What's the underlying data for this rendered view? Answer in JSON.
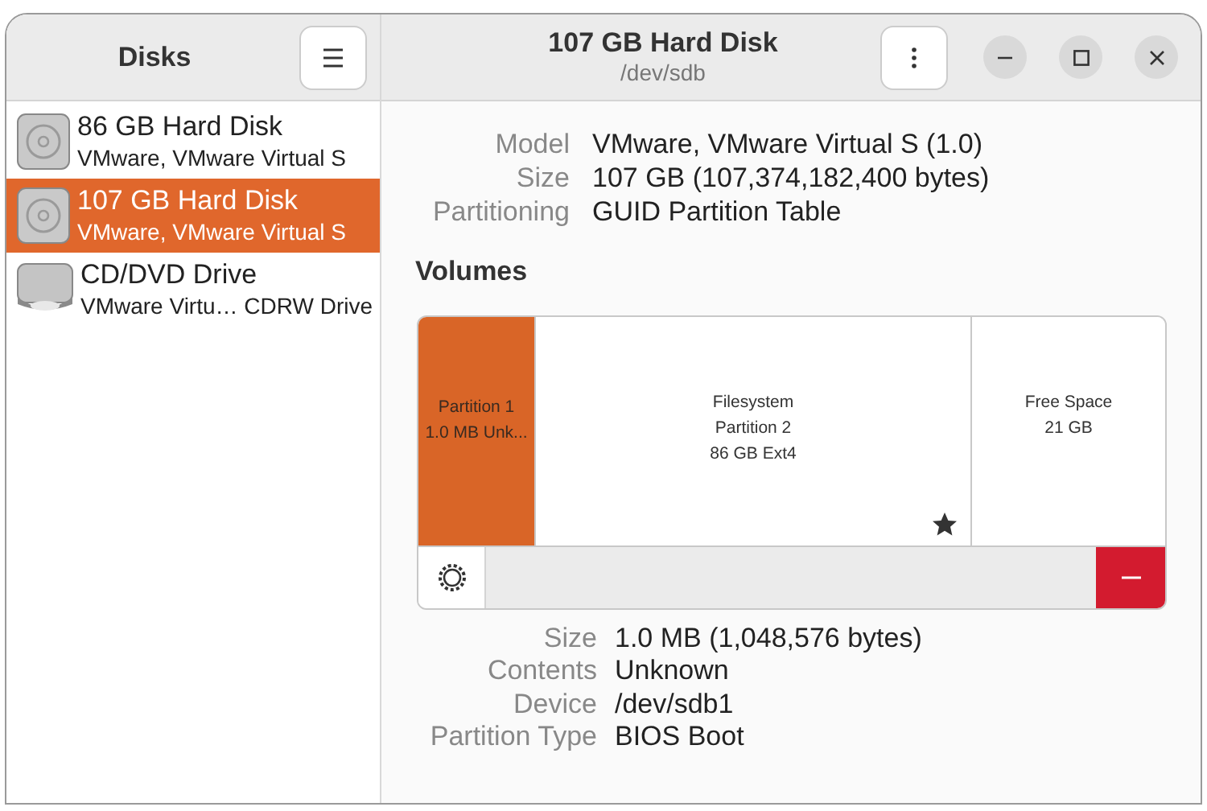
{
  "sidebar": {
    "title": "Disks",
    "items": [
      {
        "kind": "hdd",
        "name": "86 GB Hard Disk",
        "detail": "VMware, VMware Virtual S",
        "selected": false
      },
      {
        "kind": "hdd",
        "name": "107 GB Hard Disk",
        "detail": "VMware, VMware Virtual S",
        "selected": true
      },
      {
        "kind": "optical",
        "name": "CD/DVD Drive",
        "detail": "VMware Virtu… CDRW Drive",
        "selected": false
      }
    ]
  },
  "header": {
    "title": "107 GB Hard Disk",
    "subtitle": "/dev/sdb"
  },
  "disk_info": [
    {
      "label": "Model",
      "value": "VMware, VMware Virtual S (1.0)"
    },
    {
      "label": "Size",
      "value": "107 GB (107,374,182,400 bytes)"
    },
    {
      "label": "Partitioning",
      "value": "GUID Partition Table"
    }
  ],
  "volumes": {
    "title": "Volumes",
    "partitions": [
      {
        "lines": [
          "Partition 1",
          "1.0 MB Unk..."
        ],
        "selected": true,
        "starred": false
      },
      {
        "lines": [
          "Filesystem",
          "Partition 2",
          "86 GB Ext4"
        ],
        "selected": false,
        "starred": true
      },
      {
        "lines": [
          "Free Space",
          "21 GB"
        ],
        "selected": false,
        "starred": false
      }
    ]
  },
  "partition_info": [
    {
      "label": "Size",
      "value": "1.0 MB (1,048,576 bytes)"
    },
    {
      "label": "Contents",
      "value": "Unknown"
    },
    {
      "label": "Device",
      "value": "/dev/sdb1"
    },
    {
      "label": "Partition Type",
      "value": "BIOS Boot"
    }
  ]
}
